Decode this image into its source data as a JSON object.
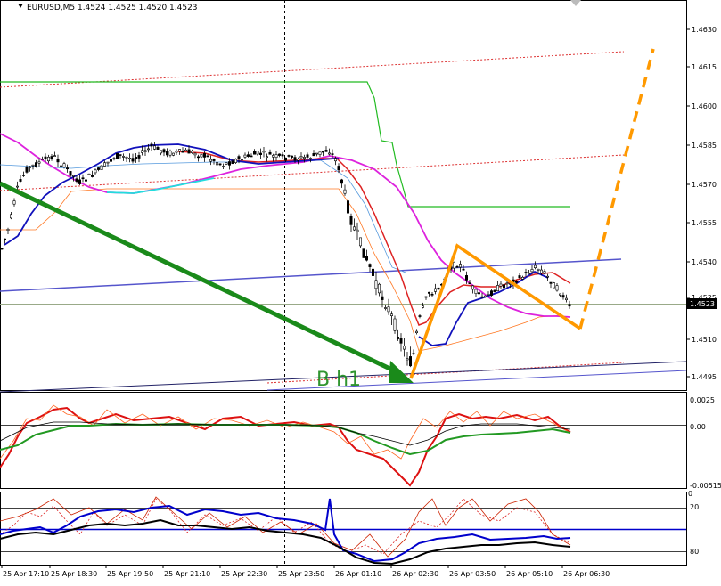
{
  "header": {
    "symbol_text": "EURUSD,M5  1.4524  1.4525  1.4520  1.4523",
    "arrow_icon": "triangle-down-icon"
  },
  "main_panel": {
    "price_axis": [
      "1.4630",
      "1.4615",
      "1.4600",
      "1.4585",
      "1.4570",
      "1.4555",
      "1.4540",
      "1.4525",
      "1.4510",
      "1.4495"
    ],
    "current_price": "1.4523",
    "annotation": "B h1",
    "colors": {
      "bull_arrow": "#1a8a1a",
      "zigzag": "#ff9900",
      "ma_red": "#dd2222",
      "ma_magenta": "#dd22dd",
      "ma_blue": "#1111bb",
      "ma_cyan": "#22dddd",
      "stop_green": "#22aa22",
      "channel_blue": "#5555cc",
      "candles": "#000000"
    }
  },
  "osc_panel_1": {
    "scale": [
      "0.0025",
      "0.00",
      "-0.00515"
    ]
  },
  "osc_panel_2": {
    "scale": [
      "20",
      "80"
    ],
    "scale_top_marker": "0"
  },
  "time_axis": [
    "25 Apr 17:10",
    "25 Apr 18:30",
    "25 Apr 19:50",
    "25 Apr 21:10",
    "25 Apr 22:30",
    "25 Apr 23:50",
    "26 Apr 01:10",
    "26 Apr 02:30",
    "26 Apr 03:50",
    "26 Apr 05:10",
    "26 Apr 06:30"
  ]
}
